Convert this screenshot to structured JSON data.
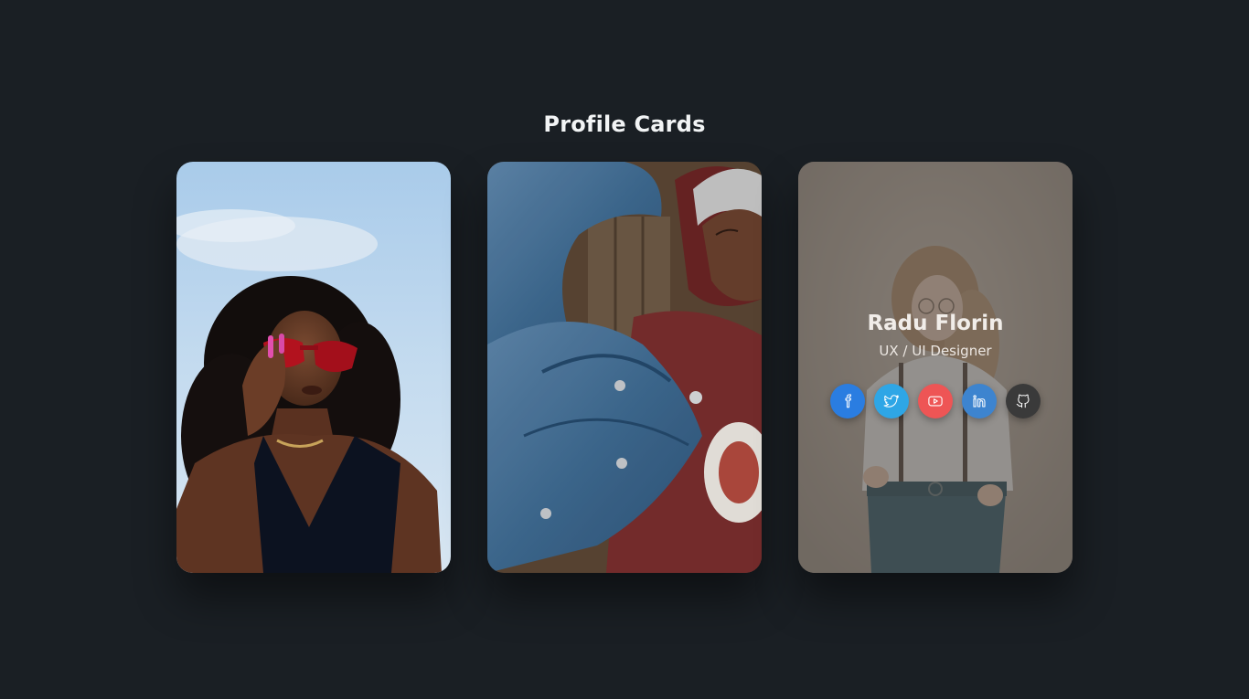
{
  "page": {
    "title": "Profile Cards"
  },
  "cards": [
    {
      "photo": "woman-red-sunglasses-photo"
    },
    {
      "photo": "man-denim-jacket-photo"
    },
    {
      "photo": "woman-suspenders-photo",
      "name": "Radu Florin",
      "role": "UX / UI Designer",
      "socials": [
        {
          "icon": "facebook-icon",
          "color": "#2a7de1"
        },
        {
          "icon": "twitter-icon",
          "color": "#2ea6e6"
        },
        {
          "icon": "youtube-icon",
          "color": "#ee5555"
        },
        {
          "icon": "linkedin-icon",
          "color": "#3d84cf"
        },
        {
          "icon": "github-icon",
          "color": "#3a3a3a"
        }
      ]
    }
  ],
  "colors": {
    "background": "#1a1f24",
    "title": "#f2f4f5"
  }
}
